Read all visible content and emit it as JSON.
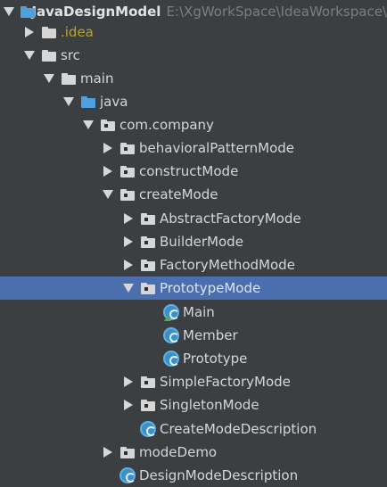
{
  "tree": {
    "root": {
      "label": "JavaDesignModel",
      "path": "E:\\XgWorkSpace\\IdeaWorkspace\\"
    },
    "idea": {
      "label": ".idea"
    },
    "src": {
      "label": "src"
    },
    "main": {
      "label": "main"
    },
    "java": {
      "label": "java"
    },
    "com_company": {
      "label": "com.company"
    },
    "behavioral": {
      "label": "behavioralPatternMode"
    },
    "construct": {
      "label": "constructMode"
    },
    "create": {
      "label": "createMode"
    },
    "abstract_factory": {
      "label": "AbstractFactoryMode"
    },
    "builder": {
      "label": "BuilderMode"
    },
    "factory_method": {
      "label": "FactoryMethodMode"
    },
    "prototype": {
      "label": "PrototypeMode"
    },
    "main_class": {
      "label": "Main"
    },
    "member_class": {
      "label": "Member"
    },
    "prototype_class": {
      "label": "Prototype"
    },
    "simple_factory": {
      "label": "SimpleFactoryMode"
    },
    "singleton": {
      "label": "SingletonMode"
    },
    "create_desc": {
      "label": "CreateModeDescription"
    },
    "mode_demo": {
      "label": "modeDemo"
    },
    "design_desc": {
      "label": "DesignModeDescription"
    }
  },
  "colors": {
    "background": "#3c3f41",
    "selection": "#4b6eaf",
    "text": "#d6d6d6",
    "folder": "#d6d6d6",
    "source_folder": "#4ea0de",
    "class_icon": "#3a90c8",
    "idea_folder_text": "#b4a43e"
  }
}
